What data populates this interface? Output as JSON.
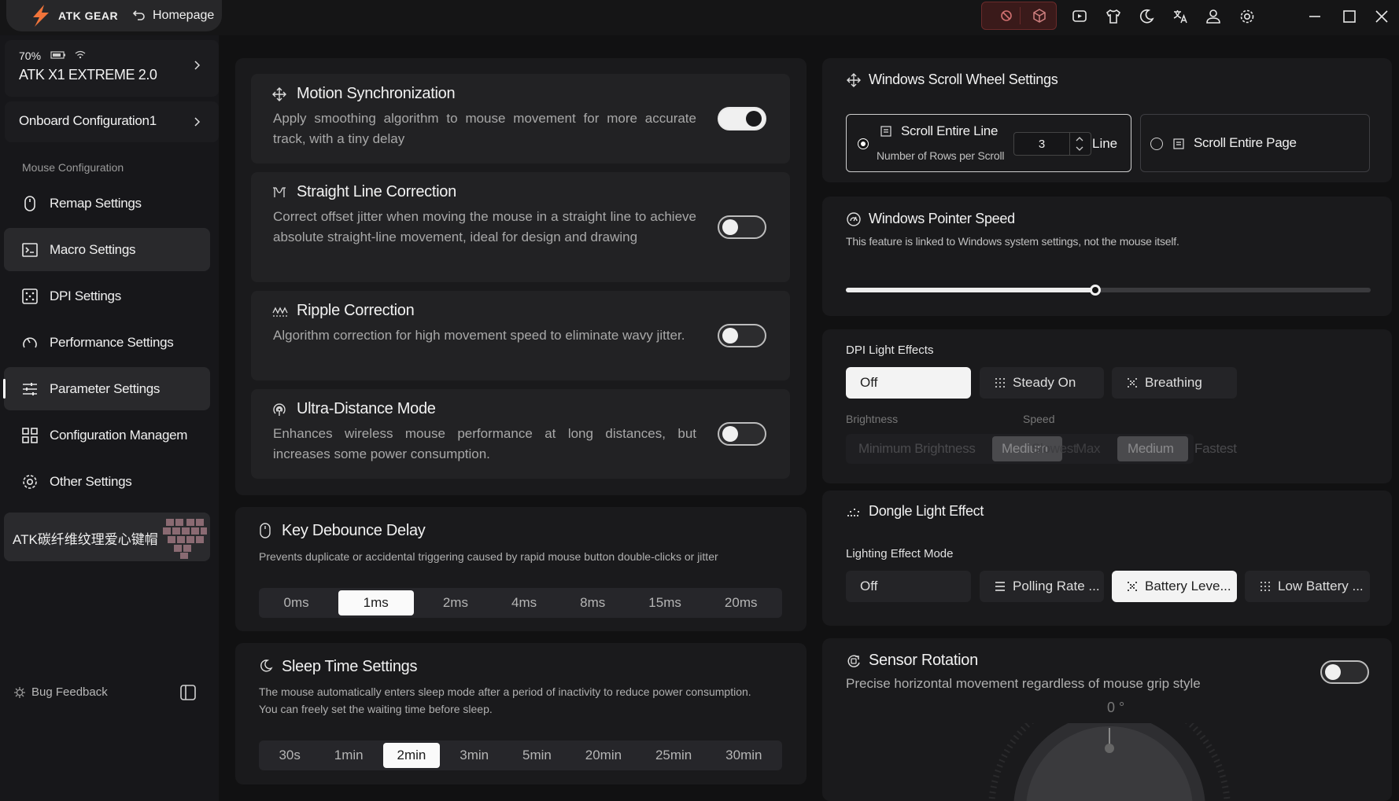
{
  "app": {
    "brand": "ATK GEAR",
    "home_label": "Homepage"
  },
  "device": {
    "battery": "70%",
    "name": "ATK X1 EXTREME 2.0",
    "config": "Onboard Configuration1"
  },
  "sidebar": {
    "section_title": "Mouse Configuration",
    "items": [
      {
        "label": "Remap Settings",
        "icon": "mouse-icon"
      },
      {
        "label": "Macro Settings",
        "icon": "terminal-icon"
      },
      {
        "label": "DPI Settings",
        "icon": "dpi-icon"
      },
      {
        "label": "Performance Settings",
        "icon": "gauge-icon"
      },
      {
        "label": "Parameter Settings",
        "icon": "sliders-icon"
      },
      {
        "label": "Configuration Managem",
        "icon": "grid-icon"
      },
      {
        "label": "Other Settings",
        "icon": "gear-icon"
      }
    ],
    "promo": "ATK碳纤维纹理爱心键帽",
    "bug_feedback": "Bug Feedback"
  },
  "motion": {
    "title": "Motion Synchronization",
    "desc": "Apply smoothing algorithm to mouse movement for more accurate track, with a tiny delay",
    "on": true
  },
  "straight": {
    "title": "Straight Line Correction",
    "desc": "Correct offset jitter when moving the mouse in a straight line to achieve absolute straight-line movement, ideal for design and drawing",
    "on": false
  },
  "ripple": {
    "title": "Ripple Correction",
    "desc": "Algorithm correction for high movement speed to eliminate wavy jitter.",
    "on": false
  },
  "ultra": {
    "title": "Ultra-Distance Mode",
    "desc": "Enhances wireless mouse performance at long distances, but increases some power consumption.",
    "on": false
  },
  "debounce": {
    "title": "Key Debounce Delay",
    "desc": "Prevents duplicate or accidental triggering caused by rapid mouse button double-clicks or jitter",
    "options": [
      "0ms",
      "1ms",
      "2ms",
      "4ms",
      "8ms",
      "15ms",
      "20ms"
    ],
    "selected": "1ms"
  },
  "sleep": {
    "title": "Sleep Time Settings",
    "desc1": "The mouse automatically enters sleep mode after a period of inactivity to reduce power consumption.",
    "desc2": "You can freely set the waiting time before sleep.",
    "options": [
      "30s",
      "1min",
      "2min",
      "3min",
      "5min",
      "20min",
      "25min",
      "30min"
    ],
    "selected": "2min"
  },
  "scroll": {
    "title": "Windows Scroll Wheel Settings",
    "line_label": "Scroll Entire Line",
    "rows_label": "Number of Rows per Scroll",
    "rows_value": "3",
    "unit": "Line",
    "page_label": "Scroll Entire Page",
    "selected": "line"
  },
  "pointer": {
    "title": "Windows Pointer Speed",
    "desc": "This feature is linked to Windows system settings, not the mouse itself.",
    "level": 0.475
  },
  "dpi_light": {
    "title": "DPI Light Effects",
    "modes": [
      "Off",
      "Steady On",
      "Breathing"
    ],
    "selected": "Off",
    "brightness_label": "Brightness",
    "speed_label": "Speed",
    "row_text": [
      "Minimum Brightness",
      "Medium",
      "Slowest",
      "Max",
      "Medium",
      "Fastest"
    ]
  },
  "dongle": {
    "title": "Dongle Light Effect",
    "mode_label": "Lighting Effect Mode",
    "modes": [
      "Off",
      "Polling Rate ...",
      "Battery Leve...",
      "Low Battery ..."
    ],
    "selected": "Battery Leve..."
  },
  "sensor": {
    "title": "Sensor Rotation",
    "desc": "Precise horizontal movement regardless of mouse grip style",
    "angle": "0 °",
    "on": false
  }
}
